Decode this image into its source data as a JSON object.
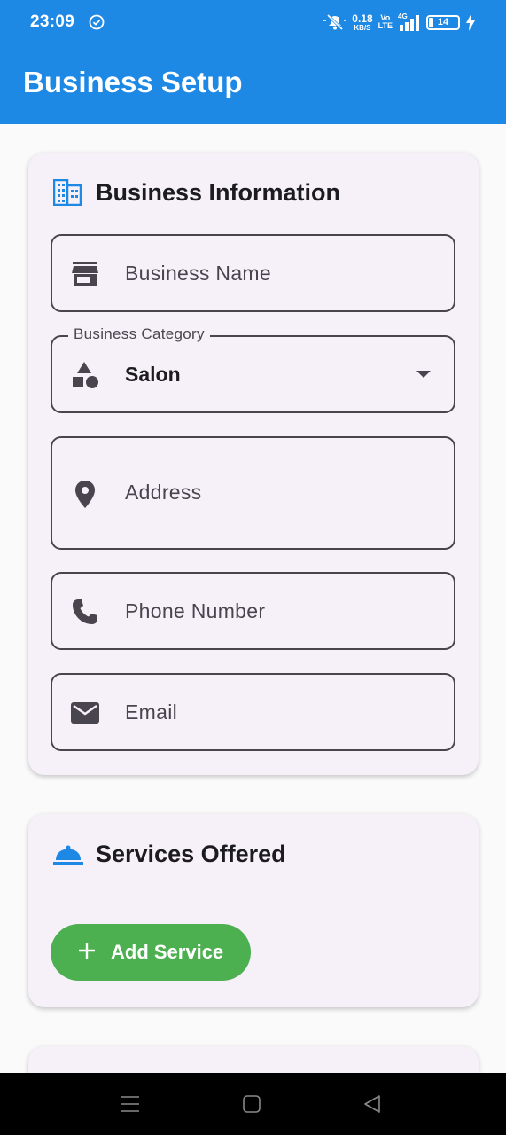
{
  "status_bar": {
    "time": "23:09",
    "net_speed_value": "0.18",
    "net_speed_unit": "KB/S",
    "volte_top": "Vo",
    "volte_bottom": "LTE",
    "network": "4G",
    "battery": "14"
  },
  "app_bar": {
    "title": "Business Setup"
  },
  "business_info": {
    "title": "Business Information",
    "fields": {
      "business_name_placeholder": "Business Name",
      "category_label": "Business Category",
      "category_value": "Salon",
      "address_placeholder": "Address",
      "phone_placeholder": "Phone Number",
      "email_placeholder": "Email"
    }
  },
  "services": {
    "title": "Services Offered",
    "add_button": "Add Service"
  },
  "colors": {
    "app_bar": "#1e88e5",
    "card_bg": "#f6f1f9",
    "add_button": "#4caf50"
  },
  "icons": [
    "check-circle-icon",
    "mute-icon",
    "signal-icon",
    "battery-icon",
    "charging-icon",
    "business-icon",
    "store-icon",
    "category-icon",
    "location-icon",
    "phone-icon",
    "email-icon",
    "room-service-icon",
    "add-icon",
    "menu-nav-icon",
    "home-nav-icon",
    "back-nav-icon"
  ]
}
